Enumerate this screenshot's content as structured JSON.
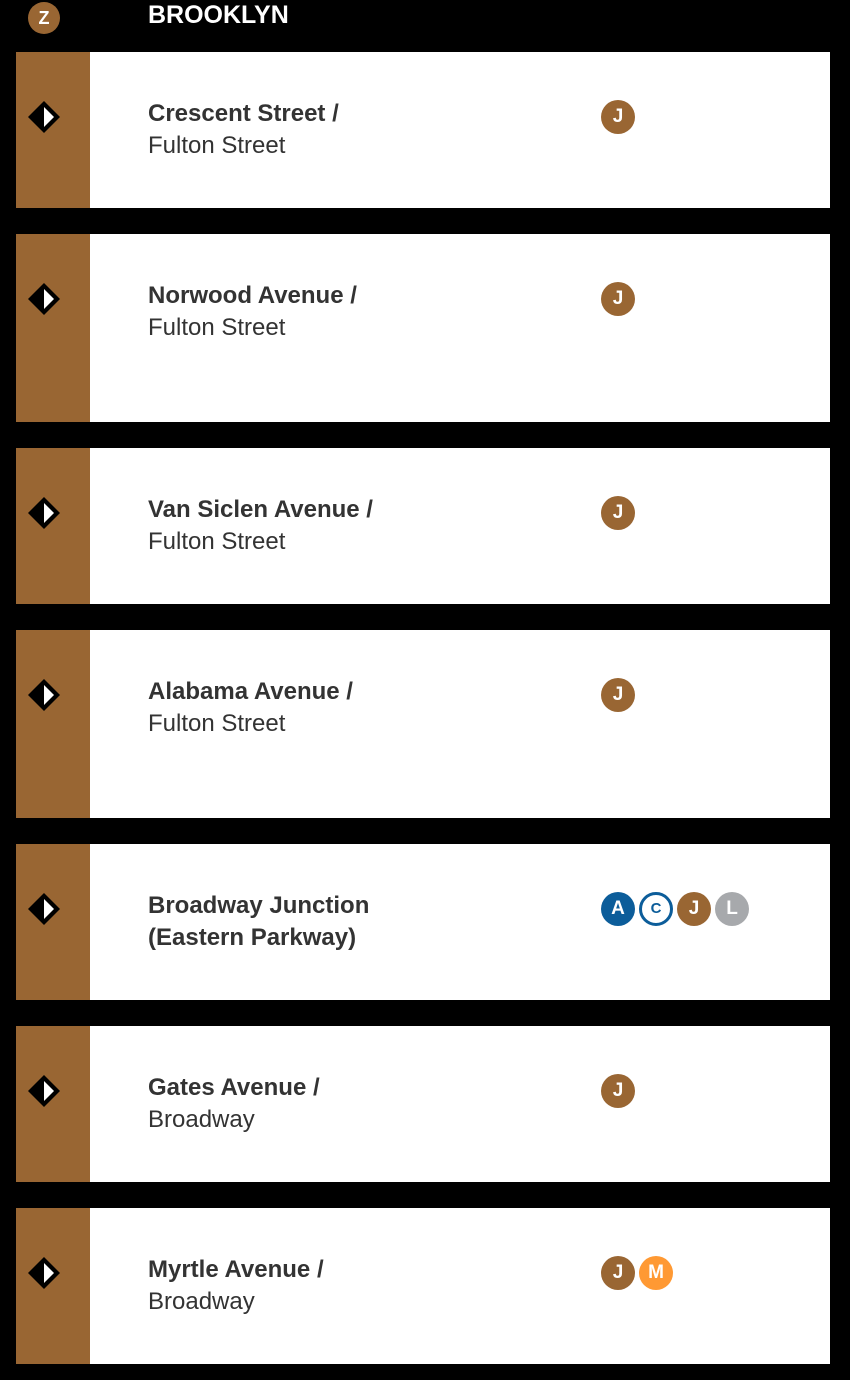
{
  "header": {
    "route": {
      "letter": "Z",
      "color": "#996633"
    },
    "borough": "BROOKLYN"
  },
  "colors": {
    "background": "#000000",
    "card": "#ffffff",
    "strip": "#996633",
    "text": "#333333"
  },
  "stations": [
    {
      "name_primary": "Crescent Street /",
      "name_secondary": "Fulton Street",
      "marker_icon": "station-diamond-icon",
      "lines": [
        {
          "letter": "J",
          "color": "#996633",
          "style": "solid"
        }
      ]
    },
    {
      "name_primary": "Norwood Avenue /",
      "name_secondary": "Fulton Street",
      "marker_icon": "station-diamond-icon",
      "lines": [
        {
          "letter": "J",
          "color": "#996633",
          "style": "solid"
        }
      ]
    },
    {
      "name_primary": "Van Siclen Avenue /",
      "name_secondary": "Fulton Street",
      "marker_icon": "station-diamond-icon",
      "lines": [
        {
          "letter": "J",
          "color": "#996633",
          "style": "solid"
        }
      ]
    },
    {
      "name_primary": "Alabama Avenue /",
      "name_secondary": "Fulton Street",
      "marker_icon": "station-diamond-icon",
      "lines": [
        {
          "letter": "J",
          "color": "#996633",
          "style": "solid"
        }
      ]
    },
    {
      "name_primary": "Broadway Junction",
      "name_secondary": "(Eastern Parkway)",
      "secondary_bold": true,
      "marker_icon": "station-diamond-icon",
      "lines": [
        {
          "letter": "A",
          "color": "#0c5d9a",
          "style": "solid"
        },
        {
          "letter": "C",
          "color": "#0c5d9a",
          "style": "local"
        },
        {
          "letter": "J",
          "color": "#996633",
          "style": "solid"
        },
        {
          "letter": "L",
          "color": "#a7a9ac",
          "style": "solid"
        }
      ]
    },
    {
      "name_primary": "Gates Avenue /",
      "name_secondary": "Broadway",
      "marker_icon": "station-diamond-icon",
      "lines": [
        {
          "letter": "J",
          "color": "#996633",
          "style": "solid"
        }
      ]
    },
    {
      "name_primary": "Myrtle Avenue /",
      "name_secondary": "Broadway",
      "marker_icon": "station-diamond-icon",
      "lines": [
        {
          "letter": "J",
          "color": "#996633",
          "style": "solid"
        },
        {
          "letter": "M",
          "color": "#ff9933",
          "style": "solid"
        }
      ]
    }
  ]
}
